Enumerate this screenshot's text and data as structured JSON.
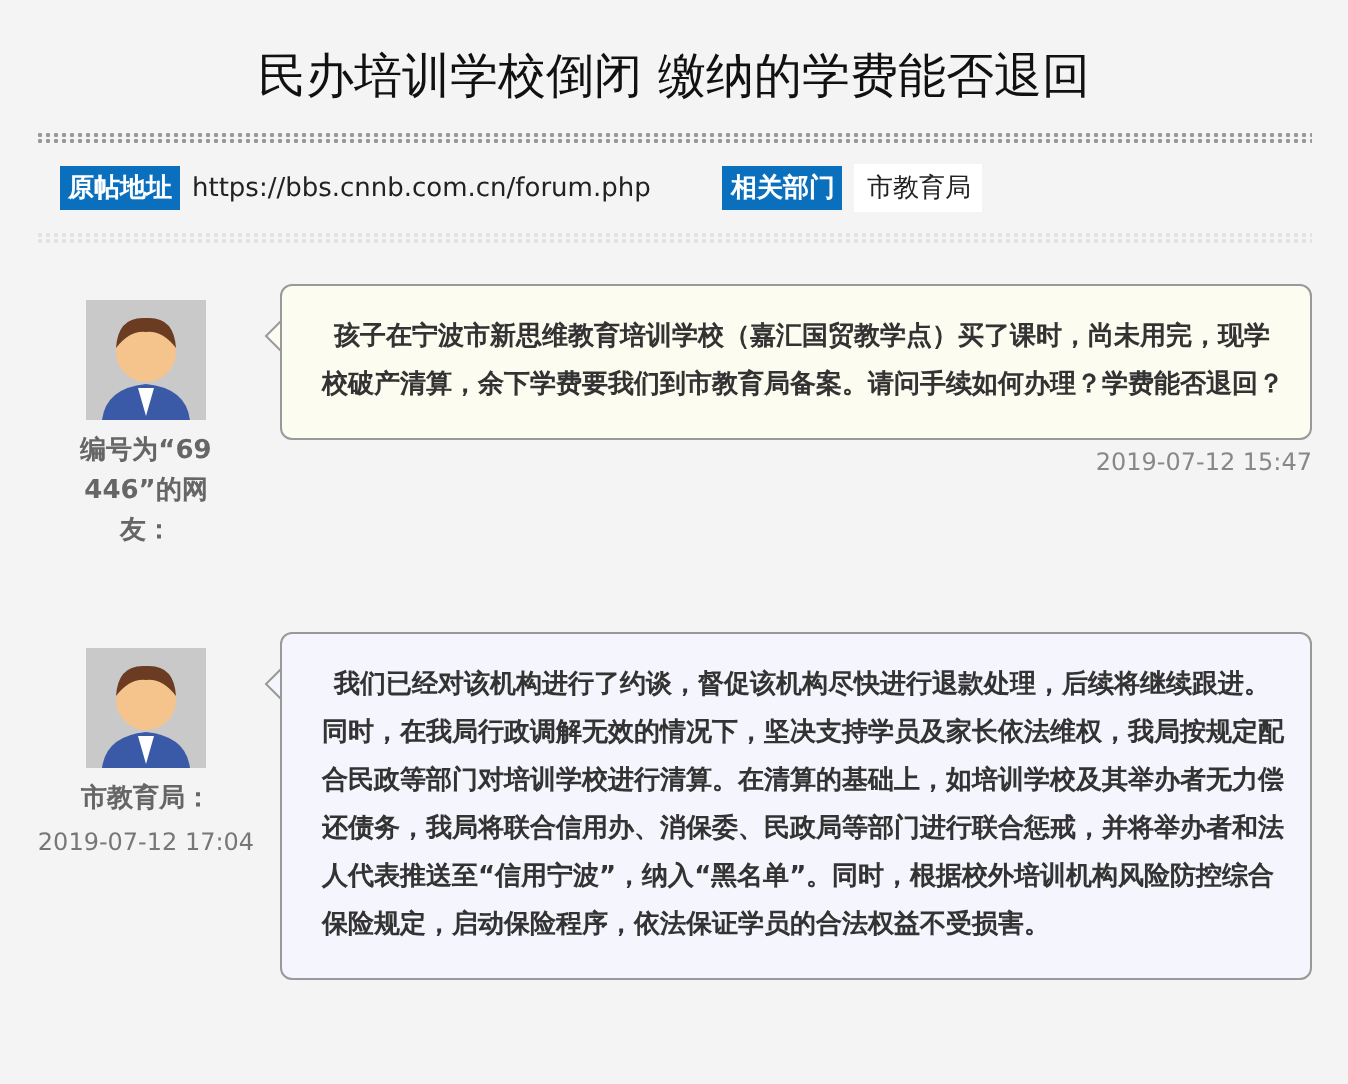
{
  "title": "民办培训学校倒闭 缴纳的学费能否退回",
  "info": [
    {
      "label": "原帖地址",
      "value": "https://bbs.cnnb.com.cn/forum.php",
      "kind": "link"
    },
    {
      "label": "相关部门",
      "value": "市教育局",
      "kind": "tag"
    }
  ],
  "posts": [
    {
      "kind": "question",
      "author": "编号为“69446”的网友：",
      "text": "孩子在宁波市新思维教育培训学校（嘉汇国贸教学点）买了课时，尚未用完，现学校破产清算，余下学费要我们到市教育局备案。请问手续如何办理？学费能否退回？",
      "time": "2019-07-12 15:47"
    },
    {
      "kind": "answer",
      "author": "市教育局：",
      "text": "我们已经对该机构进行了约谈，督促该机构尽快进行退款处理，后续将继续跟进。同时，在我局行政调解无效的情况下，坚决支持学员及家长依法维权，我局按规定配合民政等部门对培训学校进行清算。在清算的基础上，如培训学校及其举办者无力偿还债务，我局将联合信用办、消保委、民政局等部门进行联合惩戒，并将举办者和法人代表推送至“信用宁波”，纳入“黑名单”。同时，根据校外培训机构风险防控综合保险规定，启动保险程序，依法保证学员的合法权益不受损害。",
      "time": "2019-07-12 17:04"
    }
  ]
}
